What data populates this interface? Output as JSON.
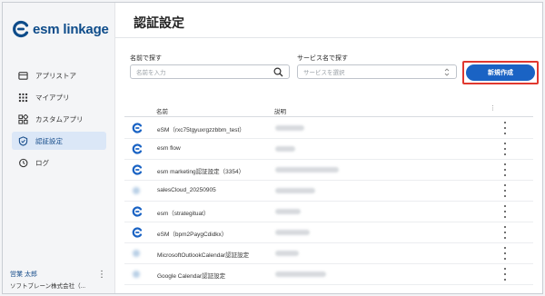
{
  "app": {
    "logo_text": "esm linkage"
  },
  "sidebar": {
    "items": [
      {
        "label": "アプリストア",
        "icon": "store-icon",
        "active": false
      },
      {
        "label": "マイアプリ",
        "icon": "grid-icon",
        "active": false
      },
      {
        "label": "カスタムアプリ",
        "icon": "widgets-icon",
        "active": false
      },
      {
        "label": "認証設定",
        "icon": "shield-icon",
        "active": true
      },
      {
        "label": "ログ",
        "icon": "history-icon",
        "active": false
      }
    ],
    "user": {
      "name": "営業 太郎",
      "org": "ソフトブレーン株式会社（..."
    }
  },
  "page": {
    "title": "認証設定"
  },
  "filters": {
    "name_label": "名前で探す",
    "name_placeholder": "名前を入力",
    "service_label": "サービス名で探す",
    "service_placeholder": "サービスを選択"
  },
  "toolbar": {
    "new_label": "新規作成"
  },
  "table": {
    "headers": {
      "name": "名前",
      "description": "説明"
    },
    "rows": [
      {
        "name": "eSM（rxc75tgyuxrgzzbbm_test）",
        "icon": "esm-logo-icon"
      },
      {
        "name": "esm flow",
        "icon": "esm-logo-icon"
      },
      {
        "name": "esm marketing認証設定（3354）",
        "icon": "esm-logo-icon"
      },
      {
        "name": "salesCloud_20250905",
        "icon": "cloud-icon"
      },
      {
        "name": "esm（strategituat）",
        "icon": "esm-logo-icon"
      },
      {
        "name": "eSM（bpm2PaygCdidkx）",
        "icon": "esm-logo-icon"
      },
      {
        "name": "MicrosoftOutlookCalendar認証設定",
        "icon": "outlook-icon"
      },
      {
        "name": "Google Calendar認証設定",
        "icon": "google-calendar-icon"
      }
    ]
  },
  "colors": {
    "brand": "#0e4c8a",
    "primary": "#1a63c4",
    "highlight": "#e0382f"
  }
}
